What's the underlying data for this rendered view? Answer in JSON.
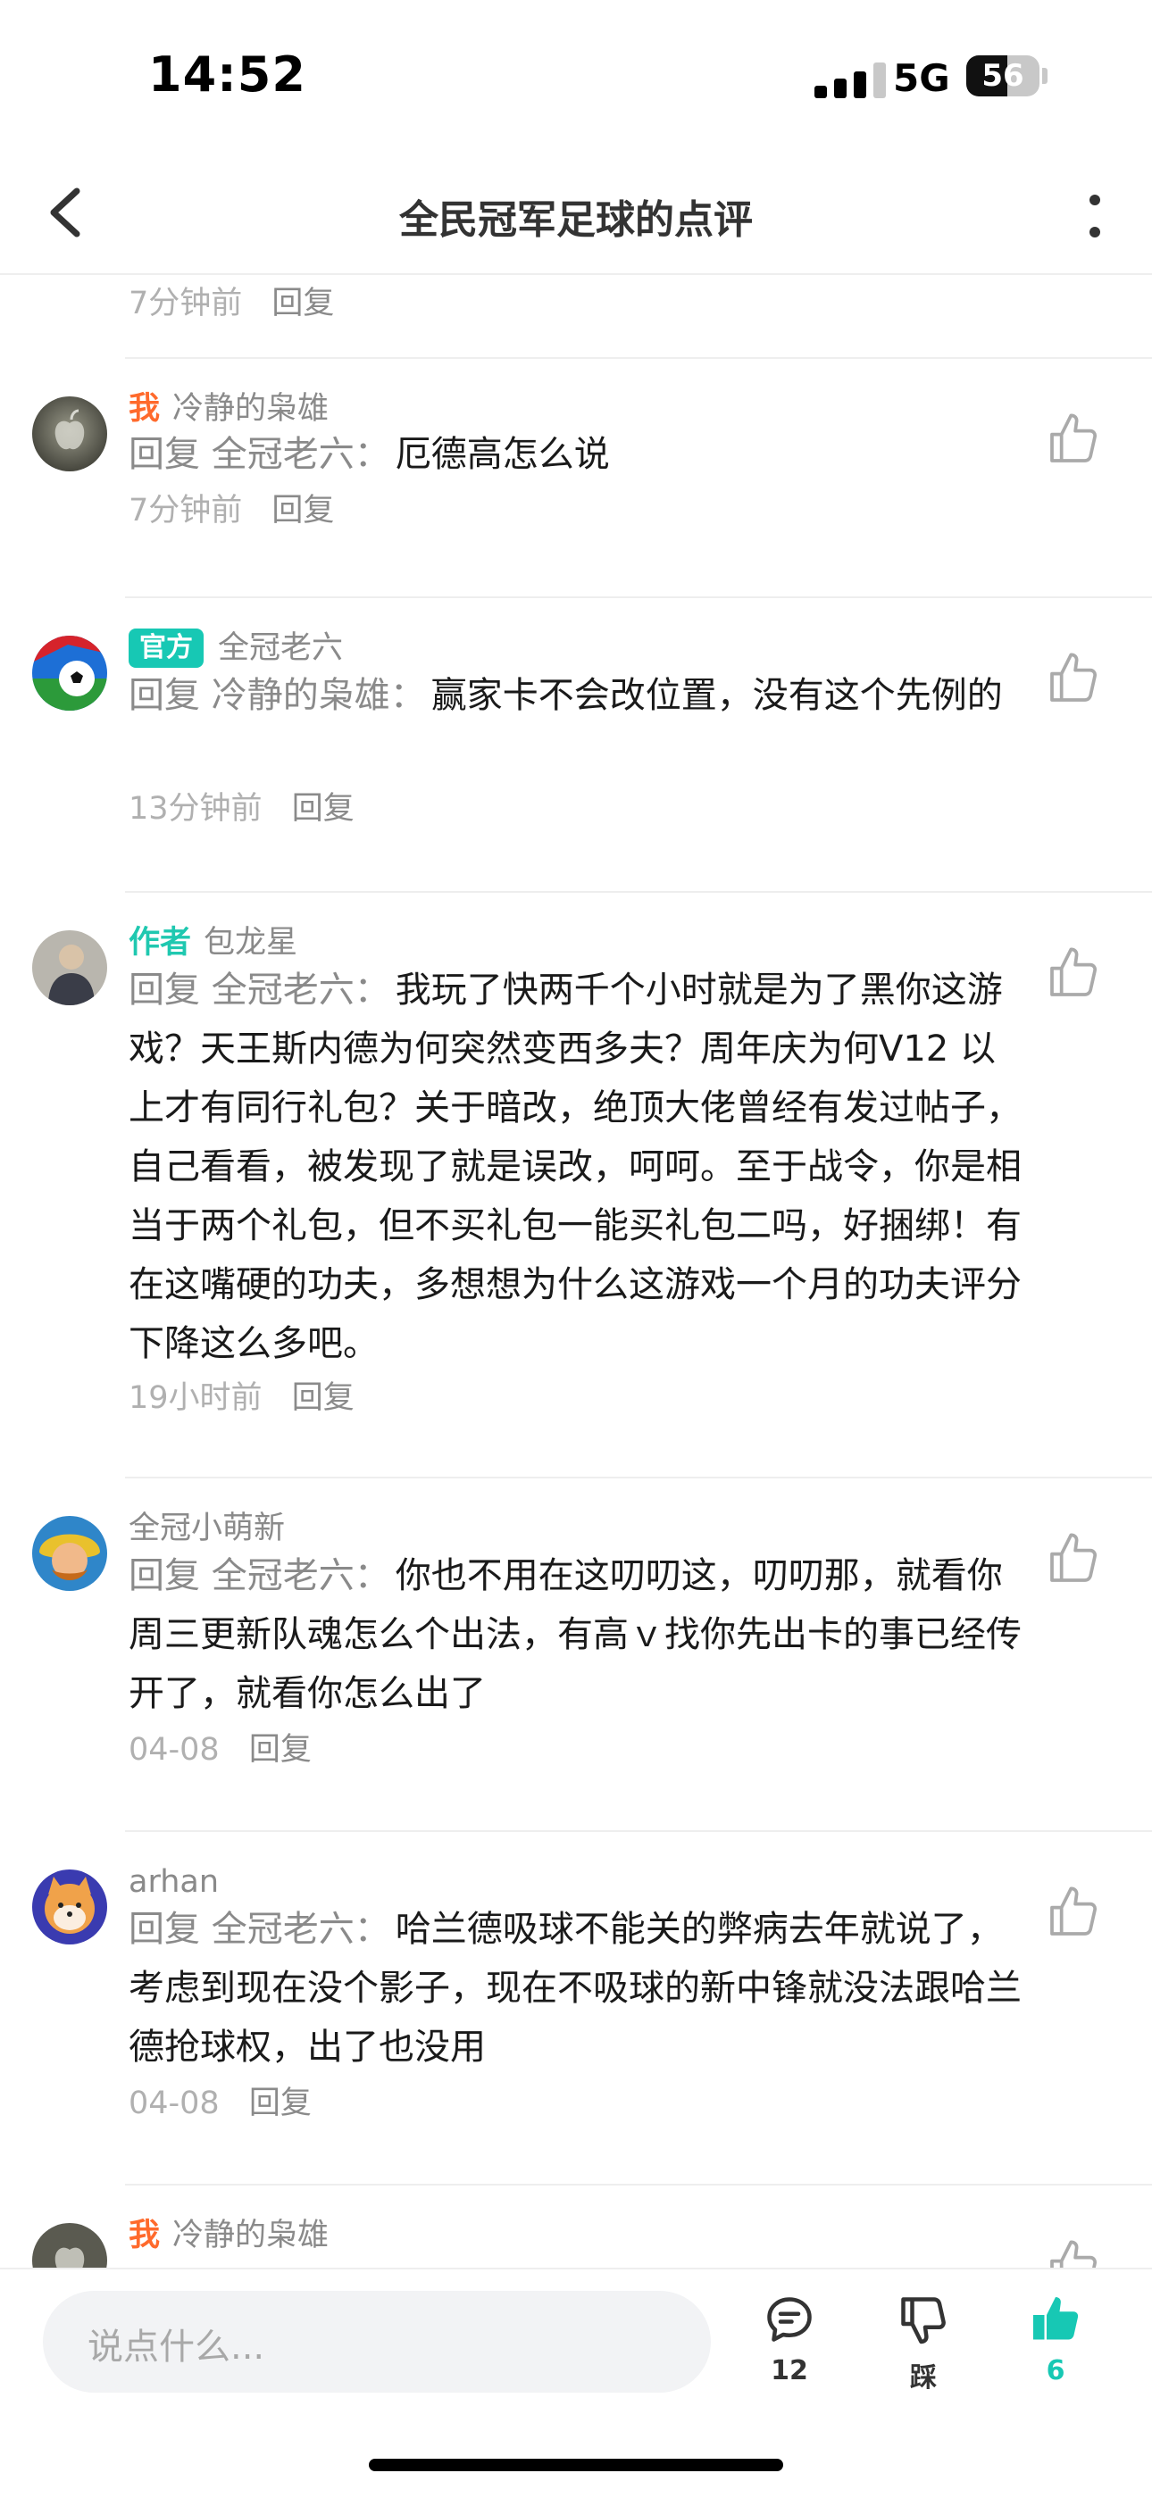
{
  "status_bar": {
    "time": "14:52",
    "network": "5G",
    "battery": "56",
    "battery_level": 0.56
  },
  "nav": {
    "title": "全民冠军足球的点评"
  },
  "comments": [
    {
      "time": "7分钟前",
      "reply": "回复"
    },
    {
      "tag": "我",
      "user": "冷静的枭雄",
      "reply_prefix": "回复 全冠老六：",
      "text": "厄德高怎么说",
      "time": "7分钟前",
      "reply": "回复"
    },
    {
      "tag": "官方",
      "user": "全冠老六",
      "reply_prefix": "回复 冷静的枭雄：",
      "text": "赢家卡不会改位置，没有这个先例的",
      "time": "13分钟前",
      "reply": "回复"
    },
    {
      "tag": "作者",
      "user": "包龙星",
      "reply_prefix": "回复 全冠老六：",
      "text": "我玩了快两千个小时就是为了黑你这游戏？天王斯内德为何突然变西多夫？周年庆为何V12 以上才有同行礼包？关于暗改，绝顶大佬曾经有发过帖子，自己看看，被发现了就是误改，呵呵。至于战令，你是相当于两个礼包，但不买礼包一能买礼包二吗，好捆绑！有在这嘴硬的功夫，多想想为什么这游戏一个月的功夫评分下降这么多吧。",
      "time": "19小时前",
      "reply": "回复"
    },
    {
      "user": "全冠小萌新",
      "reply_prefix": "回复 全冠老六：",
      "text": "你也不用在这叨叨这，叨叨那，就看你周三更新队魂怎么个出法，有高ｖ找你先出卡的事已经传开了，就看你怎么出了",
      "time": "04-08",
      "reply": "回复"
    },
    {
      "user": "arhan",
      "reply_prefix": "回复 全冠老六：",
      "text": "哈兰德吸球不能关的弊病去年就说了，考虑到现在没个影子，现在不吸球的新中锋就没法跟哈兰德抢球权，出了也没用",
      "time": "04-08",
      "reply": "回复"
    },
    {
      "tag": "我",
      "user": "冷静的枭雄"
    }
  ],
  "bottom_bar": {
    "input_placeholder": "说点什么...",
    "comment_count": "12",
    "dislike_label": "踩",
    "like_count": "6"
  },
  "colors": {
    "accent": "#17c8b4",
    "me_tag": "#ff6a2c",
    "author_tag": "#1fc8b0"
  }
}
